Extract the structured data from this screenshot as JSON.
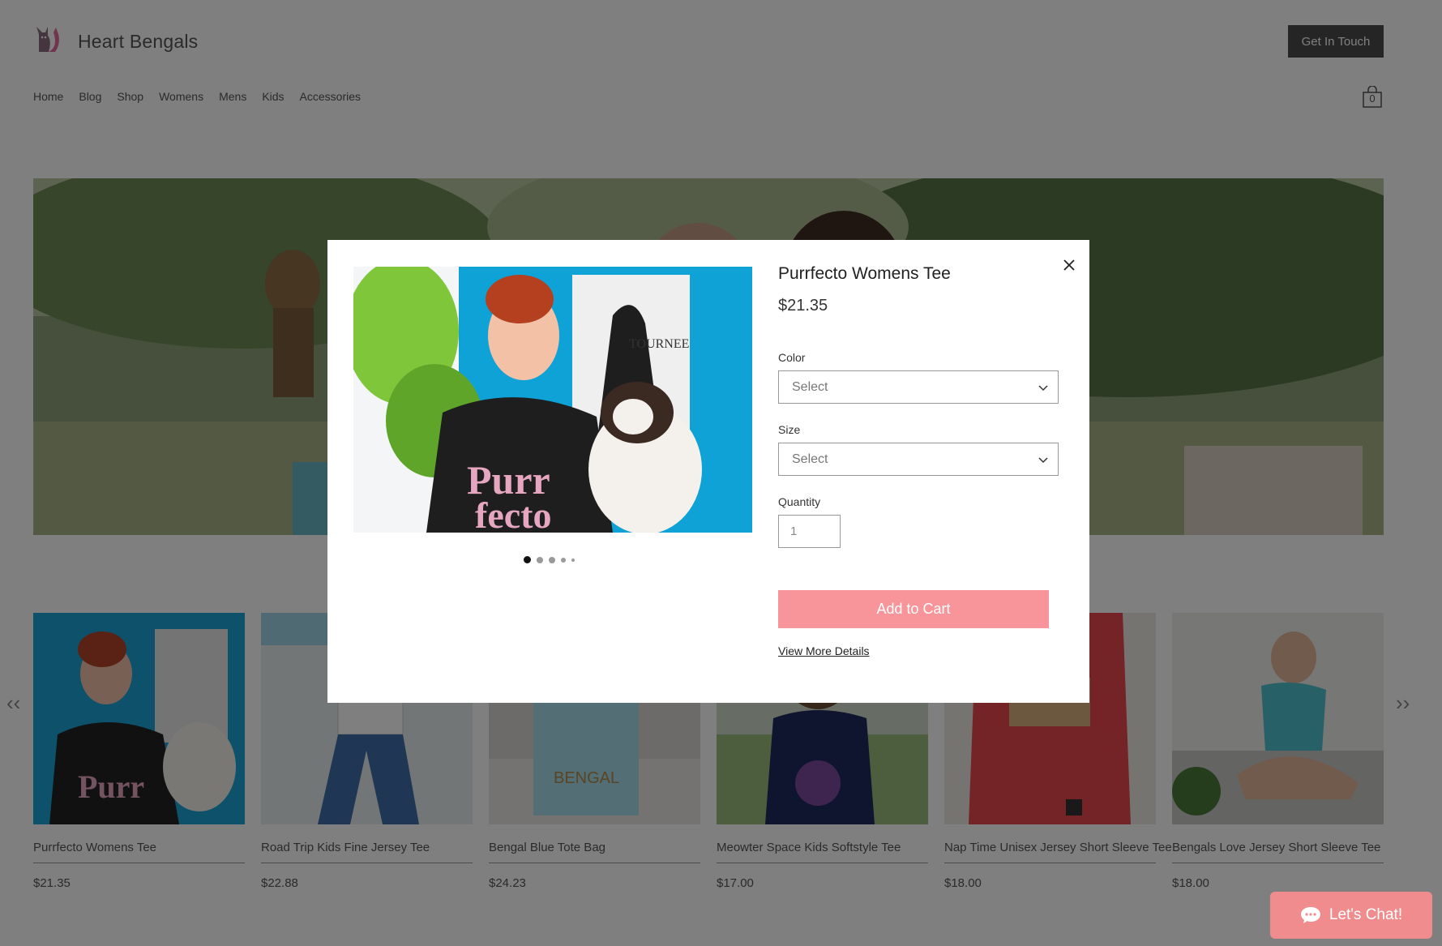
{
  "site": {
    "brand": "Heart Bengals",
    "cta_label": "Get In Touch",
    "cart_count": "0",
    "nav": [
      "Home",
      "Blog",
      "Shop",
      "Womens",
      "Mens",
      "Kids",
      "Accessories"
    ]
  },
  "products": [
    {
      "name": "Purrfecto Womens Tee",
      "price": "$21.35"
    },
    {
      "name": "Road Trip Kids Fine Jersey Tee",
      "price": "$22.88"
    },
    {
      "name": "Bengal Blue Tote Bag",
      "price": "$24.23"
    },
    {
      "name": "Meowter Space Kids Softstyle Tee",
      "price": "$17.00"
    },
    {
      "name": "Nap Time Unisex Jersey Short Sleeve Tee",
      "price": "$18.00"
    },
    {
      "name": "Bengals Love Jersey Short Sleeve Tee",
      "price": "$18.00"
    }
  ],
  "carousel": {
    "prev": "‹‹",
    "next": "››"
  },
  "chat": {
    "label": "Let's Chat!"
  },
  "modal": {
    "title": "Purrfecto Womens Tee",
    "price": "$21.35",
    "color_label": "Color",
    "color_value": "Select",
    "size_label": "Size",
    "size_value": "Select",
    "quantity_label": "Quantity",
    "quantity_value": "1",
    "add_to_cart": "Add to Cart",
    "view_more": "View More Details",
    "image_count": 5,
    "active_image": 1
  },
  "colors": {
    "accent": "#f7959a",
    "cta_bg": "#4a4a4a",
    "overlay": "rgba(0,0,0,0.5)"
  }
}
